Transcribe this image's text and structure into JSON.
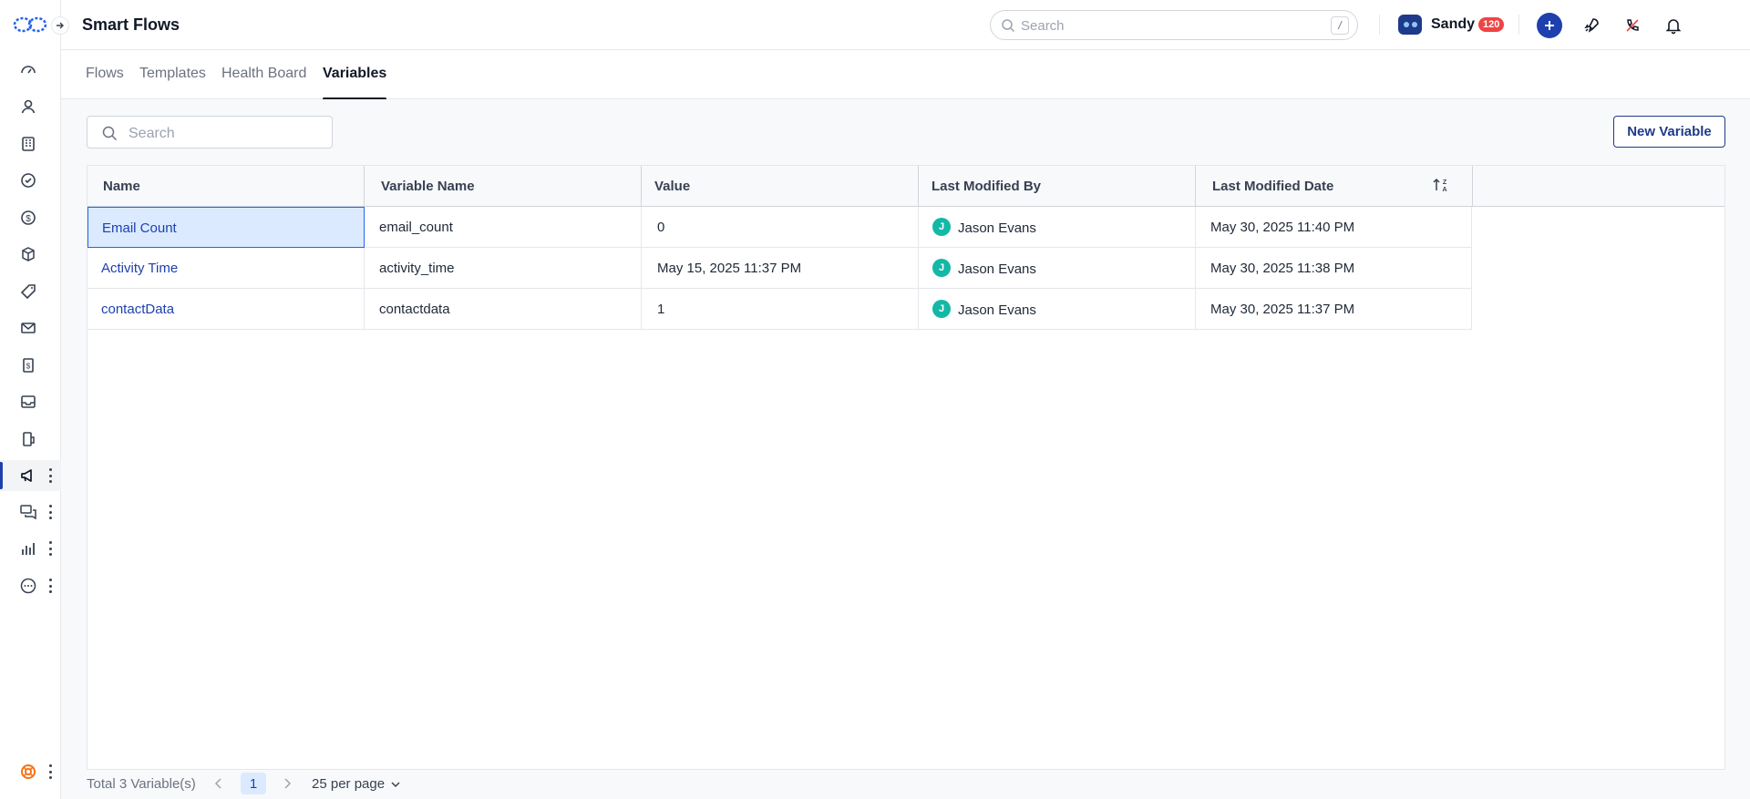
{
  "header": {
    "title": "Smart Flows",
    "search_placeholder": "Search",
    "search_shortcut": "/",
    "user_name": "Sandy",
    "user_badge": "120",
    "avatar_initial": "J"
  },
  "tabs": [
    {
      "label": "Flows"
    },
    {
      "label": "Templates"
    },
    {
      "label": "Health Board"
    },
    {
      "label": "Variables"
    }
  ],
  "toolbar": {
    "search_placeholder": "Search",
    "new_button_label": "New Variable"
  },
  "table": {
    "columns": [
      "Name",
      "Variable Name",
      "Value",
      "Last Modified By",
      "Last Modified Date"
    ],
    "rows": [
      {
        "name": "Email Count",
        "variable_name": "email_count",
        "value": "0",
        "modified_by": "Jason Evans",
        "modified_by_initial": "J",
        "modified_date": "May 30, 2025 11:40 PM"
      },
      {
        "name": "Activity Time",
        "variable_name": "activity_time",
        "value": "May 15, 2025 11:37 PM",
        "modified_by": "Jason Evans",
        "modified_by_initial": "J",
        "modified_date": "May 30, 2025 11:38 PM"
      },
      {
        "name": "contactData",
        "variable_name": "contactdata",
        "value": "1",
        "modified_by": "Jason Evans",
        "modified_by_initial": "J",
        "modified_date": "May 30, 2025 11:37 PM"
      }
    ]
  },
  "footer": {
    "total": "Total 3 Variable(s)",
    "current_page": "1",
    "per_page": "25 per page"
  },
  "colors": {
    "accent": "#1e40af",
    "avatar": "#14b8a6",
    "badge": "#ef4444",
    "selected_cell": "#dbeafe"
  },
  "sidebar": {
    "icons": [
      "dashboard-icon",
      "contacts-icon",
      "companies-icon",
      "tasks-icon",
      "deals-icon",
      "products-icon",
      "tickets-icon",
      "email-icon",
      "invoices-icon",
      "inbox-icon",
      "automation-icon",
      "campaigns-icon",
      "conversations-icon",
      "reports-icon",
      "more-icon",
      "help-icon"
    ]
  }
}
